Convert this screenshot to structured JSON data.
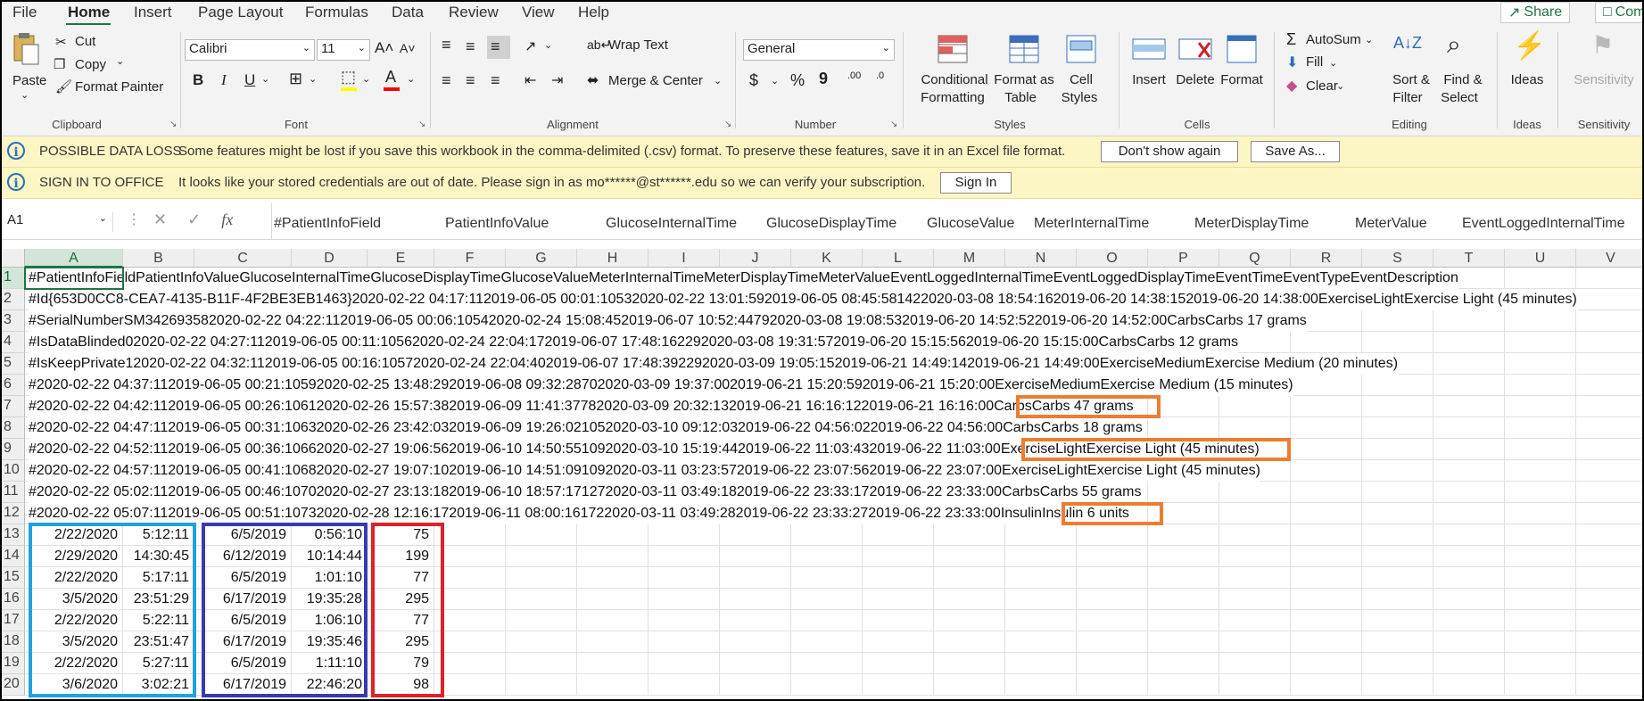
{
  "menu": {
    "items": [
      "File",
      "Home",
      "Insert",
      "Page Layout",
      "Formulas",
      "Data",
      "Review",
      "View",
      "Help"
    ],
    "active": "Home",
    "share_label": "Share",
    "comments_label": "Com"
  },
  "ribbon": {
    "clipboard": {
      "paste": "Paste",
      "cut": "Cut",
      "copy": "Copy",
      "format_painter": "Format Painter",
      "label": "Clipboard"
    },
    "font": {
      "name": "Calibri",
      "size": "11",
      "bold": "B",
      "italic": "I",
      "underline": "U",
      "label": "Font",
      "fill_color": "#ffff00",
      "font_color": "#ff0000"
    },
    "alignment": {
      "wrap_text": "Wrap Text",
      "merge_center": "Merge & Center",
      "label": "Alignment"
    },
    "number": {
      "format": "General",
      "currency": "$",
      "percent": "%",
      "comma": "9",
      "inc_decimal": ".00",
      "dec_decimal": ".0",
      "label": "Number"
    },
    "styles": {
      "conditional": "Conditional",
      "conditional2": "Formatting",
      "format_as": "Format as",
      "format_as2": "Table",
      "cell": "Cell",
      "cell2": "Styles",
      "label": "Styles"
    },
    "cells": {
      "insert": "Insert",
      "delete": "Delete",
      "format": "Format",
      "label": "Cells"
    },
    "editing": {
      "autosum": "AutoSum",
      "fill": "Fill",
      "clear": "Clear",
      "sort": "Sort &",
      "sort2": "Filter",
      "find": "Find &",
      "find2": "Select",
      "label": "Editing"
    },
    "ideas": {
      "button": "Ideas",
      "label": "Ideas"
    },
    "sensitivity": {
      "button": "Sensitivity",
      "label": "Sensitivity"
    }
  },
  "messages": [
    {
      "title": "POSSIBLE DATA LOSS",
      "text": "Some features might be lost if you save this workbook in the comma-delimited (.csv) format. To preserve these features, save it in an Excel file format.",
      "buttons": [
        "Don't show again",
        "Save As..."
      ]
    },
    {
      "title": "SIGN IN TO OFFICE",
      "text": "It looks like your stored credentials are out of date. Please sign in as mo******@st******.edu so we can verify your subscription.",
      "buttons": [
        "Sign In"
      ]
    }
  ],
  "formula_bar": {
    "name_box": "A1",
    "fx": "fx",
    "content": [
      "#PatientInfoField",
      "PatientInfoValue",
      "GlucoseInternalTime",
      "GlucoseDisplayTime",
      "GlucoseValue",
      "MeterInternalTime",
      "MeterDisplayTime",
      "MeterValue",
      "EventLoggedInternalTime"
    ]
  },
  "grid": {
    "columns": [
      "A",
      "B",
      "C",
      "D",
      "E",
      "F",
      "G",
      "H",
      "I",
      "J",
      "K",
      "L",
      "M",
      "N",
      "O",
      "P",
      "Q",
      "R",
      "S",
      "T",
      "U",
      "V"
    ],
    "selected_cell": "A1",
    "rows": [
      {
        "n": "1",
        "text": "#PatientInfoFieldPatientInfoValueGlucoseInternalTimeGlucoseDisplayTimeGlucoseValueMeterInternalTimeMeterDisplayTimeMeterValueEventLoggedInternalTimeEventLoggedDisplayTimeEventTimeEventTypeEventDescription"
      },
      {
        "n": "2",
        "text": "#Id{653D0CC8-CEA7-4135-B11F-4F2BE3EB1463}2020-02-22 04:17:112019-06-05 00:01:10532020-02-22 13:01:592019-06-05 08:45:581422020-03-08 18:54:162019-06-20 14:38:152019-06-20 14:38:00ExerciseLightExercise Light (45 minutes)"
      },
      {
        "n": "3",
        "text": "#SerialNumberSM342693582020-02-22 04:22:112019-06-05 00:06:10542020-02-24 15:08:452019-06-07 10:52:44792020-03-08 19:08:532019-06-20 14:52:522019-06-20 14:52:00CarbsCarbs 17 grams"
      },
      {
        "n": "4",
        "text": "#IsDataBlinded02020-02-22 04:27:112019-06-05 00:11:10562020-02-24 22:04:172019-06-07 17:48:162292020-03-08 19:31:572019-06-20 15:15:562019-06-20 15:15:00CarbsCarbs 12 grams"
      },
      {
        "n": "5",
        "text": "#IsKeepPrivate12020-02-22 04:32:112019-06-05 00:16:10572020-02-24 22:04:402019-06-07 17:48:392292020-03-09 19:05:152019-06-21 14:49:142019-06-21 14:49:00ExerciseMediumExercise Medium (20 minutes)"
      },
      {
        "n": "6",
        "text": "#2020-02-22 04:37:112019-06-05 00:21:10592020-02-25 13:48:292019-06-08 09:32:28702020-03-09 19:37:002019-06-21 15:20:592019-06-21 15:20:00ExerciseMediumExercise Medium (15 minutes)"
      },
      {
        "n": "7",
        "text": "#2020-02-22 04:42:112019-06-05 00:26:10612020-02-26 15:57:382019-06-09 11:41:37782020-03-09 20:32:132019-06-21 16:16:122019-06-21 16:16:00CarbsCarbs 47 grams"
      },
      {
        "n": "8",
        "text": "#2020-02-22 04:47:112019-06-05 00:31:10632020-02-26 23:42:032019-06-09 19:26:021052020-03-10 09:12:032019-06-22 04:56:022019-06-22 04:56:00CarbsCarbs 18 grams"
      },
      {
        "n": "9",
        "text": "#2020-02-22 04:52:112019-06-05 00:36:10662020-02-27 19:06:562019-06-10 14:50:551092020-03-10 15:19:442019-06-22 11:03:432019-06-22 11:03:00ExerciseLightExercise Light (45 minutes)"
      },
      {
        "n": "10",
        "text": "#2020-02-22 04:57:112019-06-05 00:41:10682020-02-27 19:07:102019-06-10 14:51:091092020-03-11 03:23:572019-06-22 23:07:562019-06-22 23:07:00ExerciseLightExercise Light (45 minutes)"
      },
      {
        "n": "11",
        "text": "#2020-02-22 05:02:112019-06-05 00:46:10702020-02-27 23:13:182019-06-10 18:57:171272020-03-11 03:49:182019-06-22 23:33:172019-06-22 23:33:00CarbsCarbs 55 grams"
      },
      {
        "n": "12",
        "text": "#2020-02-22 05:07:112019-06-05 00:51:10732020-02-28 12:16:172019-06-11 08:00:161722020-03-11 03:49:282019-06-22 23:33:272019-06-22 23:33:00InsulinInsulin 6 units"
      }
    ],
    "table_rows": [
      {
        "n": "13",
        "a": "2/22/2020",
        "b": "5:12:11",
        "c": "6/5/2019",
        "d": "0:56:10",
        "e": "75"
      },
      {
        "n": "14",
        "a": "2/29/2020",
        "b": "14:30:45",
        "c": "6/12/2019",
        "d": "10:14:44",
        "e": "199"
      },
      {
        "n": "15",
        "a": "2/22/2020",
        "b": "5:17:11",
        "c": "6/5/2019",
        "d": "1:01:10",
        "e": "77"
      },
      {
        "n": "16",
        "a": "3/5/2020",
        "b": "23:51:29",
        "c": "6/17/2019",
        "d": "19:35:28",
        "e": "295"
      },
      {
        "n": "17",
        "a": "2/22/2020",
        "b": "5:22:11",
        "c": "6/5/2019",
        "d": "1:06:10",
        "e": "77"
      },
      {
        "n": "18",
        "a": "3/5/2020",
        "b": "23:51:47",
        "c": "6/17/2019",
        "d": "19:35:46",
        "e": "295"
      },
      {
        "n": "19",
        "a": "2/22/2020",
        "b": "5:27:11",
        "c": "6/5/2019",
        "d": "1:11:10",
        "e": "79"
      },
      {
        "n": "20",
        "a": "3/6/2020",
        "b": "3:02:21",
        "c": "6/17/2019",
        "d": "22:46:20",
        "e": "98"
      }
    ]
  },
  "highlight_colors": {
    "orange": "#ed7d31",
    "light_blue": "#1fa2e0",
    "dark_blue": "#3a3ab0",
    "red": "#e0202a",
    "excel_green": "#217346"
  }
}
